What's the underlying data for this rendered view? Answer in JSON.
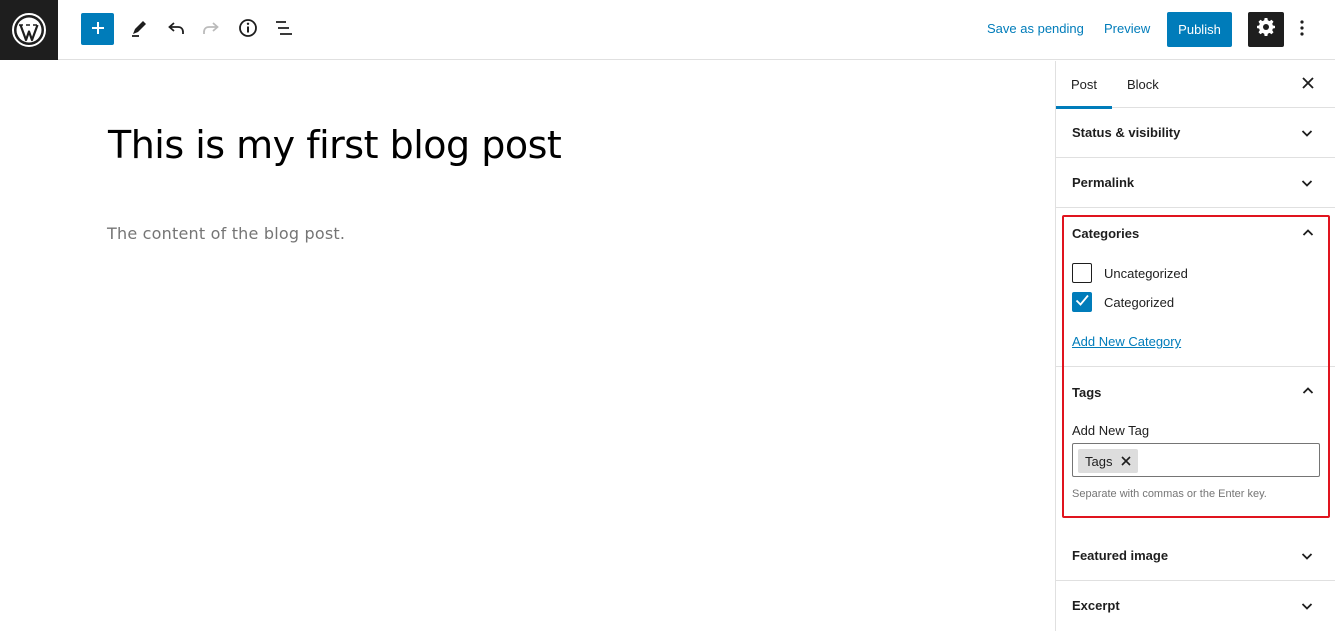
{
  "toolbar": {
    "save_pending_label": "Save as pending",
    "preview_label": "Preview",
    "publish_label": "Publish"
  },
  "editor": {
    "title": "This is my first blog post",
    "body": "The content of the blog post."
  },
  "sidebar": {
    "tabs": [
      {
        "label": "Post",
        "active": true
      },
      {
        "label": "Block",
        "active": false
      }
    ],
    "panels": {
      "status_visibility": "Status & visibility",
      "permalink": "Permalink",
      "featured_image": "Featured image",
      "excerpt": "Excerpt"
    },
    "categories": {
      "title": "Categories",
      "items": [
        {
          "label": "Uncategorized",
          "checked": false
        },
        {
          "label": "Categorized",
          "checked": true
        }
      ],
      "add_new_label": "Add New Category"
    },
    "tags": {
      "title": "Tags",
      "field_label": "Add New Tag",
      "chips": [
        "Tags"
      ],
      "help_text": "Separate with commas or the Enter key."
    }
  },
  "colors": {
    "accent": "#007cba",
    "dark": "#1e1e1e",
    "highlight_border": "#e0141e"
  },
  "icons": [
    "wordpress-logo-icon",
    "plus-icon",
    "pencil-icon",
    "undo-icon",
    "redo-icon",
    "info-icon",
    "list-view-icon",
    "gear-icon",
    "more-vertical-icon",
    "close-icon",
    "chevron-down-icon",
    "chevron-up-icon",
    "checkmark-icon"
  ]
}
